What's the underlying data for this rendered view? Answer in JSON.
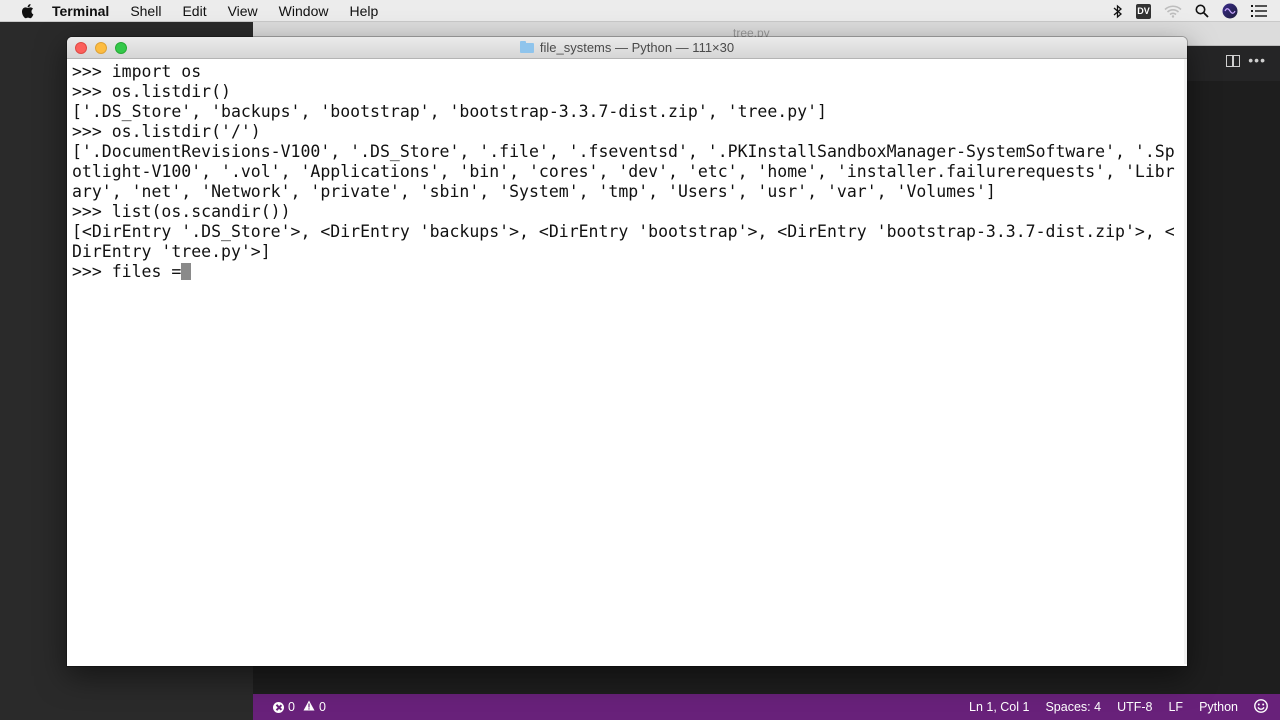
{
  "menubar": {
    "app": "Terminal",
    "items": [
      "Shell",
      "Edit",
      "View",
      "Window",
      "Help"
    ],
    "status_icons": [
      "bluetooth-icon",
      "dv-badge",
      "wifi-icon",
      "search-icon",
      "siri-icon",
      "list-icon"
    ],
    "dv_badge": "DV"
  },
  "editor": {
    "tab_title": "tree.py"
  },
  "terminal": {
    "title": "file_systems — Python — 111×30",
    "lines": [
      ">>> import os",
      ">>> os.listdir()",
      "['.DS_Store', 'backups', 'bootstrap', 'bootstrap-3.3.7-dist.zip', 'tree.py']",
      ">>> os.listdir('/')",
      "['.DocumentRevisions-V100', '.DS_Store', '.file', '.fseventsd', '.PKInstallSandboxManager-SystemSoftware', '.Sp",
      "otlight-V100', '.vol', 'Applications', 'bin', 'cores', 'dev', 'etc', 'home', 'installer.failurerequests', 'Libr",
      "ary', 'net', 'Network', 'private', 'sbin', 'System', 'tmp', 'Users', 'usr', 'var', 'Volumes']",
      ">>> list(os.scandir())",
      "[<DirEntry '.DS_Store'>, <DirEntry 'backups'>, <DirEntry 'bootstrap'>, <DirEntry 'bootstrap-3.3.7-dist.zip'>, <",
      "DirEntry 'tree.py'>]"
    ],
    "current_input": ">>> files ="
  },
  "statusbar": {
    "errors": "0",
    "warnings": "0",
    "position": "Ln 1, Col 1",
    "spaces": "Spaces: 4",
    "encoding": "UTF-8",
    "eol": "LF",
    "language": "Python"
  },
  "colors": {
    "statusbar_bg": "#68217a",
    "terminal_bg": "#ffffff",
    "editor_bg": "#1e1e1e"
  }
}
